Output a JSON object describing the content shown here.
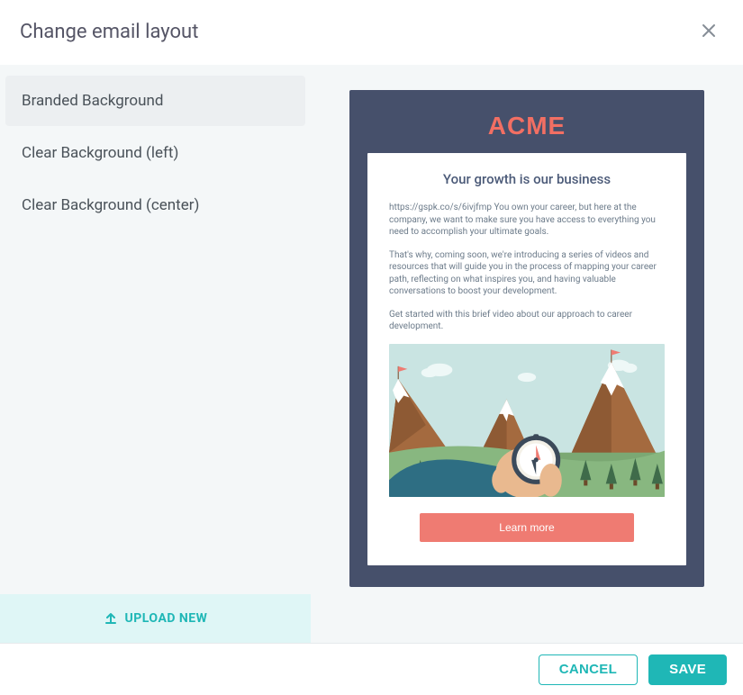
{
  "header": {
    "title": "Change email layout"
  },
  "sidebar": {
    "items": [
      {
        "label": "Branded Background",
        "selected": true
      },
      {
        "label": "Clear Background (left)",
        "selected": false
      },
      {
        "label": "Clear Background (center)",
        "selected": false
      }
    ],
    "upload_label": "UPLOAD NEW"
  },
  "preview": {
    "brand": "ACME",
    "headline": "Your growth is our business",
    "paragraphs": [
      "https://gspk.co/s/6ivjfmp You own your career, but here at the company, we want to make sure you have access to everything you need to accomplish your ultimate goals.",
      "That's why, coming soon, we're introducing a series of videos and resources that will guide you in the process of mapping your career path, reflecting on what inspires you, and having valuable conversations to boost your development.",
      "Get started with this brief video about our approach to career development."
    ],
    "cta_label": "Learn more"
  },
  "footer": {
    "cancel_label": "CANCEL",
    "save_label": "SAVE"
  },
  "colors": {
    "accent": "#1fb7b6",
    "brand_red": "#f26f63",
    "email_bg": "#46506b",
    "cta": "#ef7b72"
  }
}
